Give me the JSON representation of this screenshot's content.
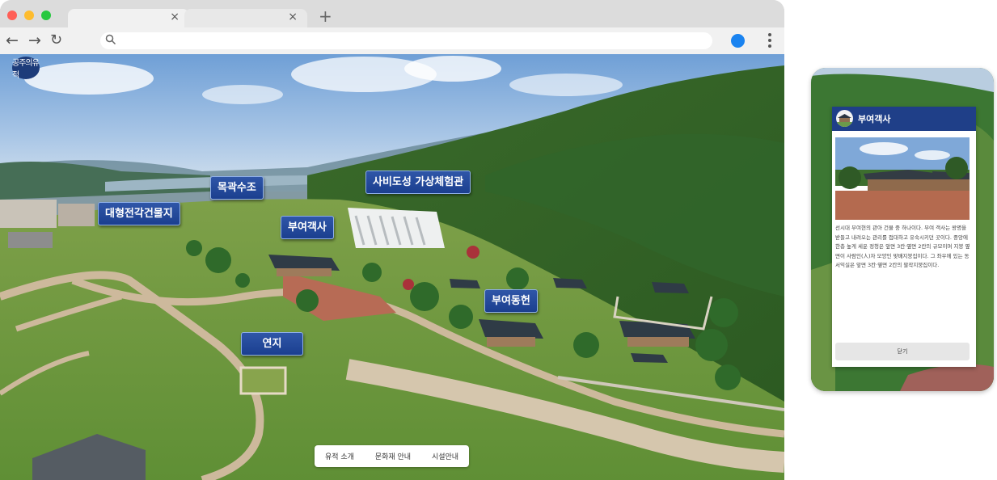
{
  "browser": {
    "tabs": [
      {
        "close_glyph": "×"
      },
      {
        "close_glyph": "×"
      }
    ],
    "new_tab_glyph": "+",
    "nav": {
      "back_glyph": "←",
      "forward_glyph": "→",
      "reload_glyph": "↻"
    },
    "url": ""
  },
  "site": {
    "logo_text": "공주의유적",
    "map_labels": {
      "building_site": "대형전각건물지",
      "wooden_water": "목곽수조",
      "vr_hall": "사비도성 가상체험관",
      "guesthouse": "부여객사",
      "office": "부여동헌",
      "pond": "연지"
    },
    "bottom_nav": [
      "유적 소개",
      "문화재 안내",
      "시설안내"
    ]
  },
  "mobile": {
    "popup_title": "부여객사",
    "description": "선시대 부여현의 관아 건물 중 하나이다. 부여 객사는 왕명을 받들고 내려오는 관리를 접대하고 유숙시키던 곳이다. 중앙에 한층 높게 세운 정청은 앞면 3칸·옆면 2칸의 규모이며 지붕 옆면이 사람인(人)자 모양인 맞배지붕집이다. 그 좌우에 있는 동서익실은 앞면 3칸·옆면 2칸의 팔작지붕집이다.",
    "close_label": "닫기"
  },
  "colors": {
    "label_blue": "#1b3f8f",
    "popup_header": "#1f3f88",
    "profile_blue": "#1a83f0"
  }
}
